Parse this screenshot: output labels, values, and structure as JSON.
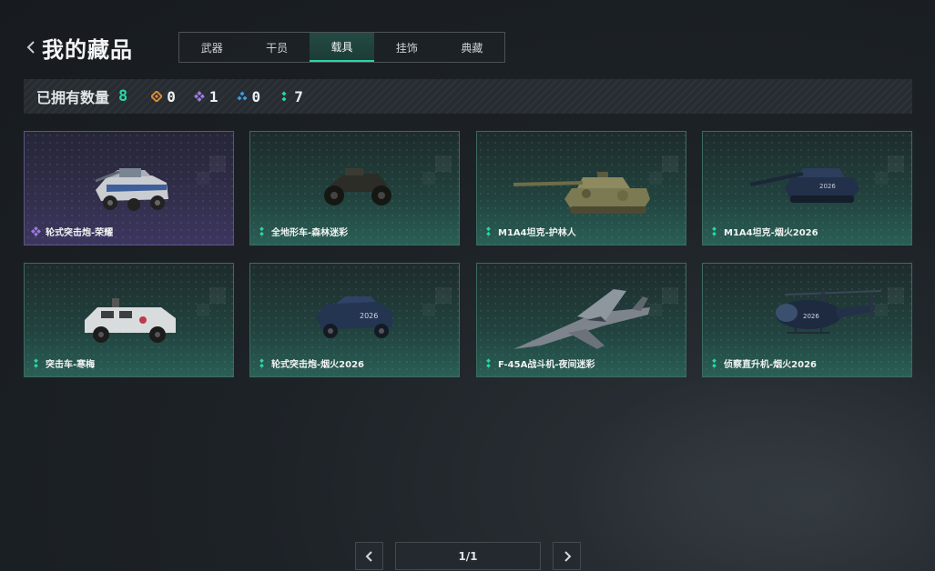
{
  "header": {
    "title": "我的藏品",
    "back_icon": "chevron-left-icon"
  },
  "tabs": [
    {
      "label": "武器",
      "active": false
    },
    {
      "label": "干员",
      "active": false
    },
    {
      "label": "载具",
      "active": true
    },
    {
      "label": "挂饰",
      "active": false
    },
    {
      "label": "典藏",
      "active": false
    }
  ],
  "stats": {
    "label": "已拥有数量",
    "total": "8",
    "rarities": [
      {
        "icon": "orange-diamond-icon",
        "color": "#d98a3a",
        "count": "0"
      },
      {
        "icon": "purple-diamond-icon",
        "color": "#9a7de0",
        "count": "1"
      },
      {
        "icon": "blue-diamond-icon",
        "color": "#3b9be0",
        "count": "0"
      },
      {
        "icon": "green-diamond-icon",
        "color": "#2ad6a5",
        "count": "7"
      }
    ]
  },
  "items": [
    {
      "name": "轮式突击炮-荣耀",
      "rarity": "purple",
      "vehicle": "wheeled-assault-gun-white"
    },
    {
      "name": "全地形车-森林迷彩",
      "rarity": "green",
      "vehicle": "atv-dark"
    },
    {
      "name": "M1A4坦克-护林人",
      "rarity": "green",
      "vehicle": "tank-camo"
    },
    {
      "name": "M1A4坦克-烟火2026",
      "rarity": "green",
      "vehicle": "tank-blue"
    },
    {
      "name": "突击车-寒梅",
      "rarity": "green",
      "vehicle": "assault-car-white"
    },
    {
      "name": "轮式突击炮-烟火2026",
      "rarity": "green",
      "vehicle": "wheeled-assault-gun-blue"
    },
    {
      "name": "F-45A战斗机-夜间迷彩",
      "rarity": "green",
      "vehicle": "fighter-jet-camo"
    },
    {
      "name": "侦察直升机-烟火2026",
      "rarity": "green",
      "vehicle": "helicopter-blue"
    }
  ],
  "pagination": {
    "text": "1/1",
    "prev_icon": "chevron-left-icon",
    "next_icon": "chevron-right-icon"
  },
  "colors": {
    "accent": "#2ad6a5",
    "purple": "#9a7de0",
    "green": "#2ad6a5"
  }
}
